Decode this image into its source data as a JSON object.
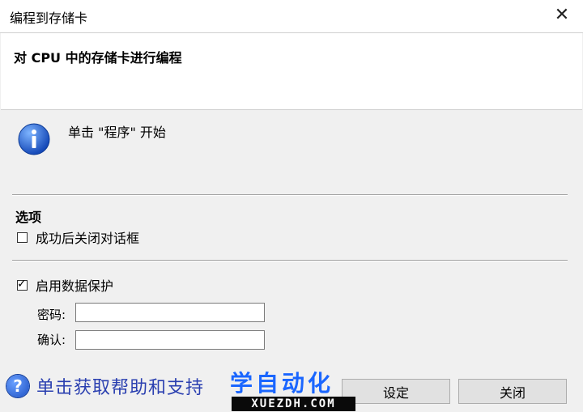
{
  "window": {
    "title": "编程到存储卡",
    "close_glyph": "✕"
  },
  "header": {
    "text": "对 CPU 中的存储卡进行编程"
  },
  "instruction": {
    "text": "单击 \"程序\" 开始",
    "icon": "info-icon"
  },
  "options": {
    "section_title": "选项",
    "close_on_success": {
      "label": "成功后关闭对话框",
      "checked": false
    }
  },
  "protection": {
    "enable": {
      "label": "启用数据保护",
      "checked": true
    },
    "password_label": "密码:",
    "password_value": "",
    "confirm_label": "确认:",
    "confirm_value": ""
  },
  "footer": {
    "help_icon": "question-icon",
    "help_text": "单击获取帮助和支持",
    "set_button": "设定",
    "close_button": "关闭"
  },
  "watermark": {
    "cn": "学自动化",
    "en": "XUEZDH.COM"
  }
}
